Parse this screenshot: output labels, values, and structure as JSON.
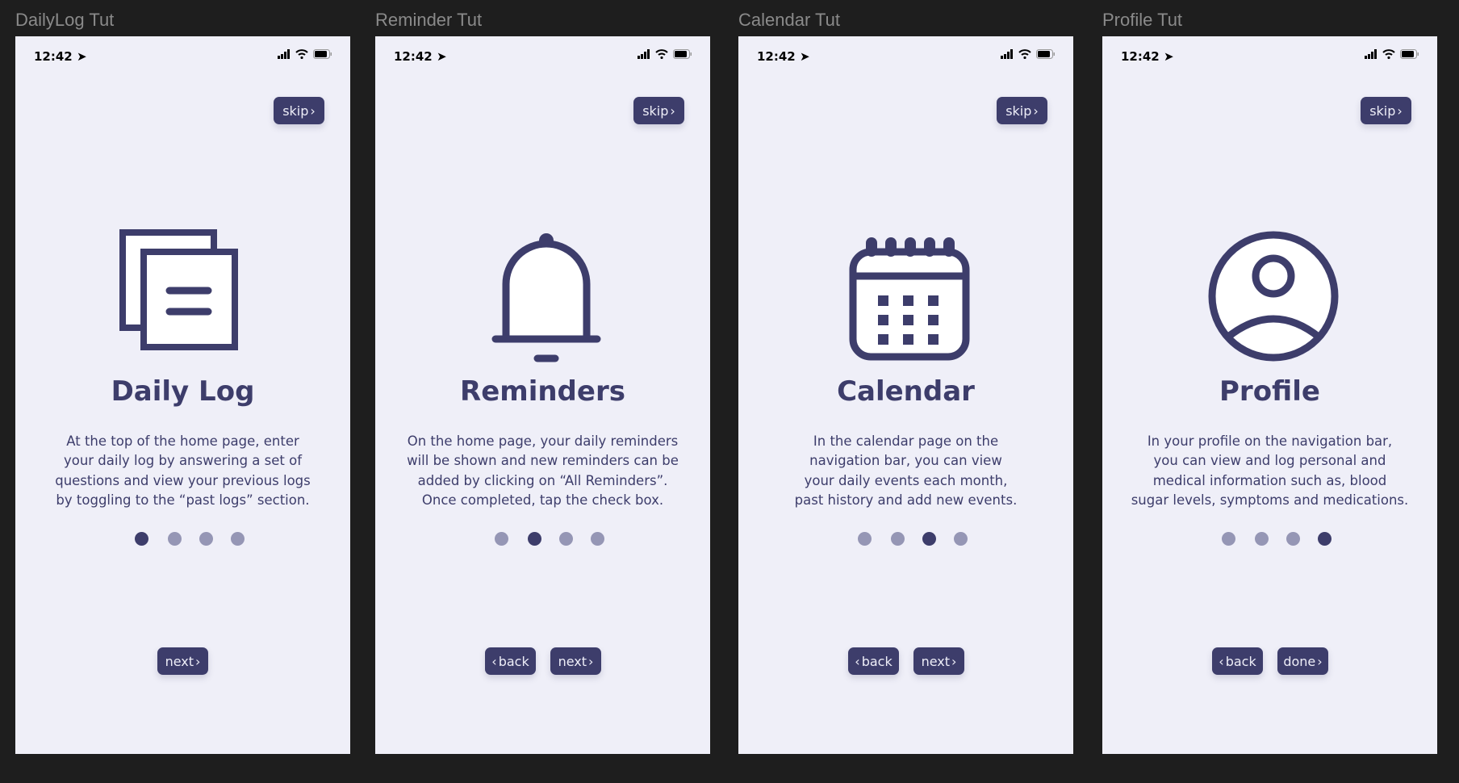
{
  "colors": {
    "primary": "#3d3d6b",
    "inactive_dot": "#9596b5",
    "screen_bg": "#efeff8",
    "canvas_bg": "#1e1e1e"
  },
  "status_bar": {
    "time": "12:42",
    "icons": [
      "location-arrow-icon",
      "signal-icon",
      "wifi-icon",
      "battery-icon"
    ]
  },
  "frames": [
    {
      "label": "DailyLog Tut",
      "skip": "skip",
      "icon": "documents-icon",
      "title": "Daily Log",
      "body": [
        "At the top of the home page, enter",
        "your daily log by answering a set of",
        "questions and view your previous logs",
        "by toggling to the “past logs” section."
      ],
      "active_dot": 0,
      "back": null,
      "next": "next"
    },
    {
      "label": "Reminder Tut",
      "skip": "skip",
      "icon": "bell-icon",
      "title": "Reminders",
      "body": [
        "On the home page, your daily reminders",
        "will be shown and new reminders can be",
        "added by clicking on “All Reminders”.",
        "Once completed, tap the check box."
      ],
      "active_dot": 1,
      "back": "back",
      "next": "next"
    },
    {
      "label": "Calendar Tut",
      "skip": "skip",
      "icon": "calendar-icon",
      "title": "Calendar",
      "body": [
        "In the calendar page on the",
        "navigation bar, you can view",
        "your daily events each month,",
        "past history and add new events."
      ],
      "active_dot": 2,
      "back": "back",
      "next": "next"
    },
    {
      "label": "Profile Tut",
      "skip": "skip",
      "icon": "user-circle-icon",
      "title": "Profile",
      "body": [
        "In your profile on the navigation bar,",
        "you can view and log personal and",
        "medical information such as, blood",
        "sugar levels, symptoms and medications."
      ],
      "active_dot": 3,
      "back": "back",
      "next": "done"
    }
  ]
}
